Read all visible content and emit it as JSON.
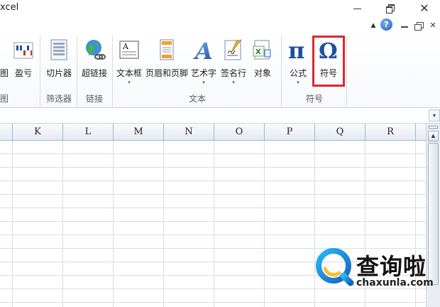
{
  "window": {
    "title": "xcel",
    "minimize_label": "",
    "restore_label": "",
    "close_label": "✕"
  },
  "ribbon_controls": {
    "collapse_glyph": "▲",
    "help_glyph": "?",
    "close_glyph": "✕"
  },
  "ribbon": {
    "buttons": [
      {
        "label": "图",
        "icon": "chart-icon"
      },
      {
        "label": "盈亏",
        "icon": "winloss-sparkline-icon"
      },
      {
        "label": "切片器",
        "icon": "slicer-icon"
      },
      {
        "label": "超链接",
        "icon": "hyperlink-globe-icon"
      },
      {
        "label": "文本框",
        "icon": "text-box-icon",
        "dropdown": "▾"
      },
      {
        "label": "页眉和页脚",
        "icon": "header-footer-icon"
      },
      {
        "label": "艺术字",
        "icon": "wordart-icon",
        "dropdown": "▾"
      },
      {
        "label": "签名行",
        "icon": "signature-line-icon",
        "dropdown": "▾"
      },
      {
        "label": "对象",
        "icon": "object-icon"
      },
      {
        "label": "公式",
        "icon": "pi-equation-icon",
        "dropdown": "▾"
      },
      {
        "label": "符号",
        "icon": "omega-symbol-icon"
      }
    ],
    "groups": [
      {
        "label": "图"
      },
      {
        "label": "筛选器"
      },
      {
        "label": "链接"
      },
      {
        "label": "文本"
      },
      {
        "label": "符号"
      }
    ],
    "highlight_color": "#d9292f"
  },
  "formula_bar": {
    "expand_glyph": "▾"
  },
  "sheet": {
    "columns": [
      "K",
      "L",
      "M",
      "N",
      "O",
      "P",
      "Q",
      "R"
    ]
  },
  "scrollbar": {
    "up_glyph": "▲"
  },
  "watermark": {
    "title": "查询啦",
    "url": "chaxunla.com"
  }
}
